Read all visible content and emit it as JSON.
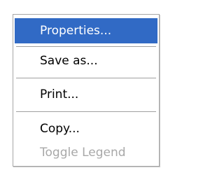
{
  "context_menu": {
    "items": [
      {
        "label": "Properties...",
        "state": "highlighted"
      },
      {
        "label": "Save as...",
        "state": "enabled"
      },
      {
        "label": "Print...",
        "state": "enabled"
      },
      {
        "label": "Copy...",
        "state": "enabled"
      },
      {
        "label": "Toggle Legend",
        "state": "disabled"
      }
    ]
  },
  "colors": {
    "highlight": "#316ac5",
    "highlight_text": "#ffffff",
    "text": "#000000",
    "disabled_text": "#a8a8a8",
    "border": "#a6a6a6",
    "background": "#ffffff"
  }
}
